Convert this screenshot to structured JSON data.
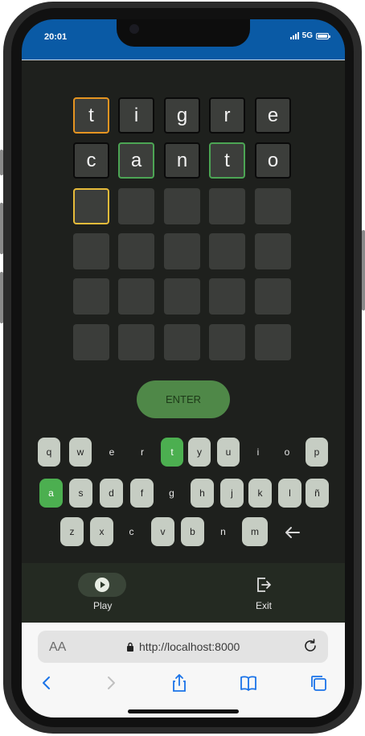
{
  "status": {
    "time": "20:01",
    "network": "5G"
  },
  "board": {
    "rows": [
      [
        {
          "letter": "t",
          "state": "orange"
        },
        {
          "letter": "i",
          "state": "filled"
        },
        {
          "letter": "g",
          "state": "filled"
        },
        {
          "letter": "r",
          "state": "filled"
        },
        {
          "letter": "e",
          "state": "filled"
        }
      ],
      [
        {
          "letter": "c",
          "state": "filled"
        },
        {
          "letter": "a",
          "state": "green"
        },
        {
          "letter": "n",
          "state": "filled"
        },
        {
          "letter": "t",
          "state": "green"
        },
        {
          "letter": "o",
          "state": "filled"
        }
      ],
      [
        {
          "letter": "",
          "state": "yellow"
        },
        {
          "letter": "",
          "state": "empty"
        },
        {
          "letter": "",
          "state": "empty"
        },
        {
          "letter": "",
          "state": "empty"
        },
        {
          "letter": "",
          "state": "empty"
        }
      ],
      [
        {
          "letter": "",
          "state": "empty"
        },
        {
          "letter": "",
          "state": "empty"
        },
        {
          "letter": "",
          "state": "empty"
        },
        {
          "letter": "",
          "state": "empty"
        },
        {
          "letter": "",
          "state": "empty"
        }
      ],
      [
        {
          "letter": "",
          "state": "empty"
        },
        {
          "letter": "",
          "state": "empty"
        },
        {
          "letter": "",
          "state": "empty"
        },
        {
          "letter": "",
          "state": "empty"
        },
        {
          "letter": "",
          "state": "empty"
        }
      ],
      [
        {
          "letter": "",
          "state": "empty"
        },
        {
          "letter": "",
          "state": "empty"
        },
        {
          "letter": "",
          "state": "empty"
        },
        {
          "letter": "",
          "state": "empty"
        },
        {
          "letter": "",
          "state": "empty"
        }
      ]
    ]
  },
  "enter_label": "ENTER",
  "keyboard": {
    "rows": [
      [
        {
          "k": "q",
          "s": "used"
        },
        {
          "k": "w",
          "s": "used"
        },
        {
          "k": "e",
          "s": "plain"
        },
        {
          "k": "r",
          "s": "plain"
        },
        {
          "k": "t",
          "s": "hit"
        },
        {
          "k": "y",
          "s": "used"
        },
        {
          "k": "u",
          "s": "used"
        },
        {
          "k": "i",
          "s": "plain"
        },
        {
          "k": "o",
          "s": "plain"
        },
        {
          "k": "p",
          "s": "used"
        }
      ],
      [
        {
          "k": "a",
          "s": "hit"
        },
        {
          "k": "s",
          "s": "used"
        },
        {
          "k": "d",
          "s": "used"
        },
        {
          "k": "f",
          "s": "used"
        },
        {
          "k": "g",
          "s": "plain"
        },
        {
          "k": "h",
          "s": "used"
        },
        {
          "k": "j",
          "s": "used"
        },
        {
          "k": "k",
          "s": "used"
        },
        {
          "k": "l",
          "s": "used"
        },
        {
          "k": "ñ",
          "s": "used"
        }
      ],
      [
        {
          "k": "z",
          "s": "used"
        },
        {
          "k": "x",
          "s": "used"
        },
        {
          "k": "c",
          "s": "plain"
        },
        {
          "k": "v",
          "s": "used"
        },
        {
          "k": "b",
          "s": "used"
        },
        {
          "k": "n",
          "s": "plain"
        },
        {
          "k": "m",
          "s": "used"
        }
      ]
    ],
    "backspace_icon": "arrow-left-icon"
  },
  "nav": {
    "play_label": "Play",
    "exit_label": "Exit",
    "play_icon": "play-circle-icon",
    "exit_icon": "exit-icon"
  },
  "browser": {
    "text_size_label": "AA",
    "url": "http://localhost:8000"
  },
  "colors": {
    "correct": "#4caf50",
    "present": "#e59421",
    "active": "#e6bb3a",
    "status_bar": "#0a5aa5"
  }
}
